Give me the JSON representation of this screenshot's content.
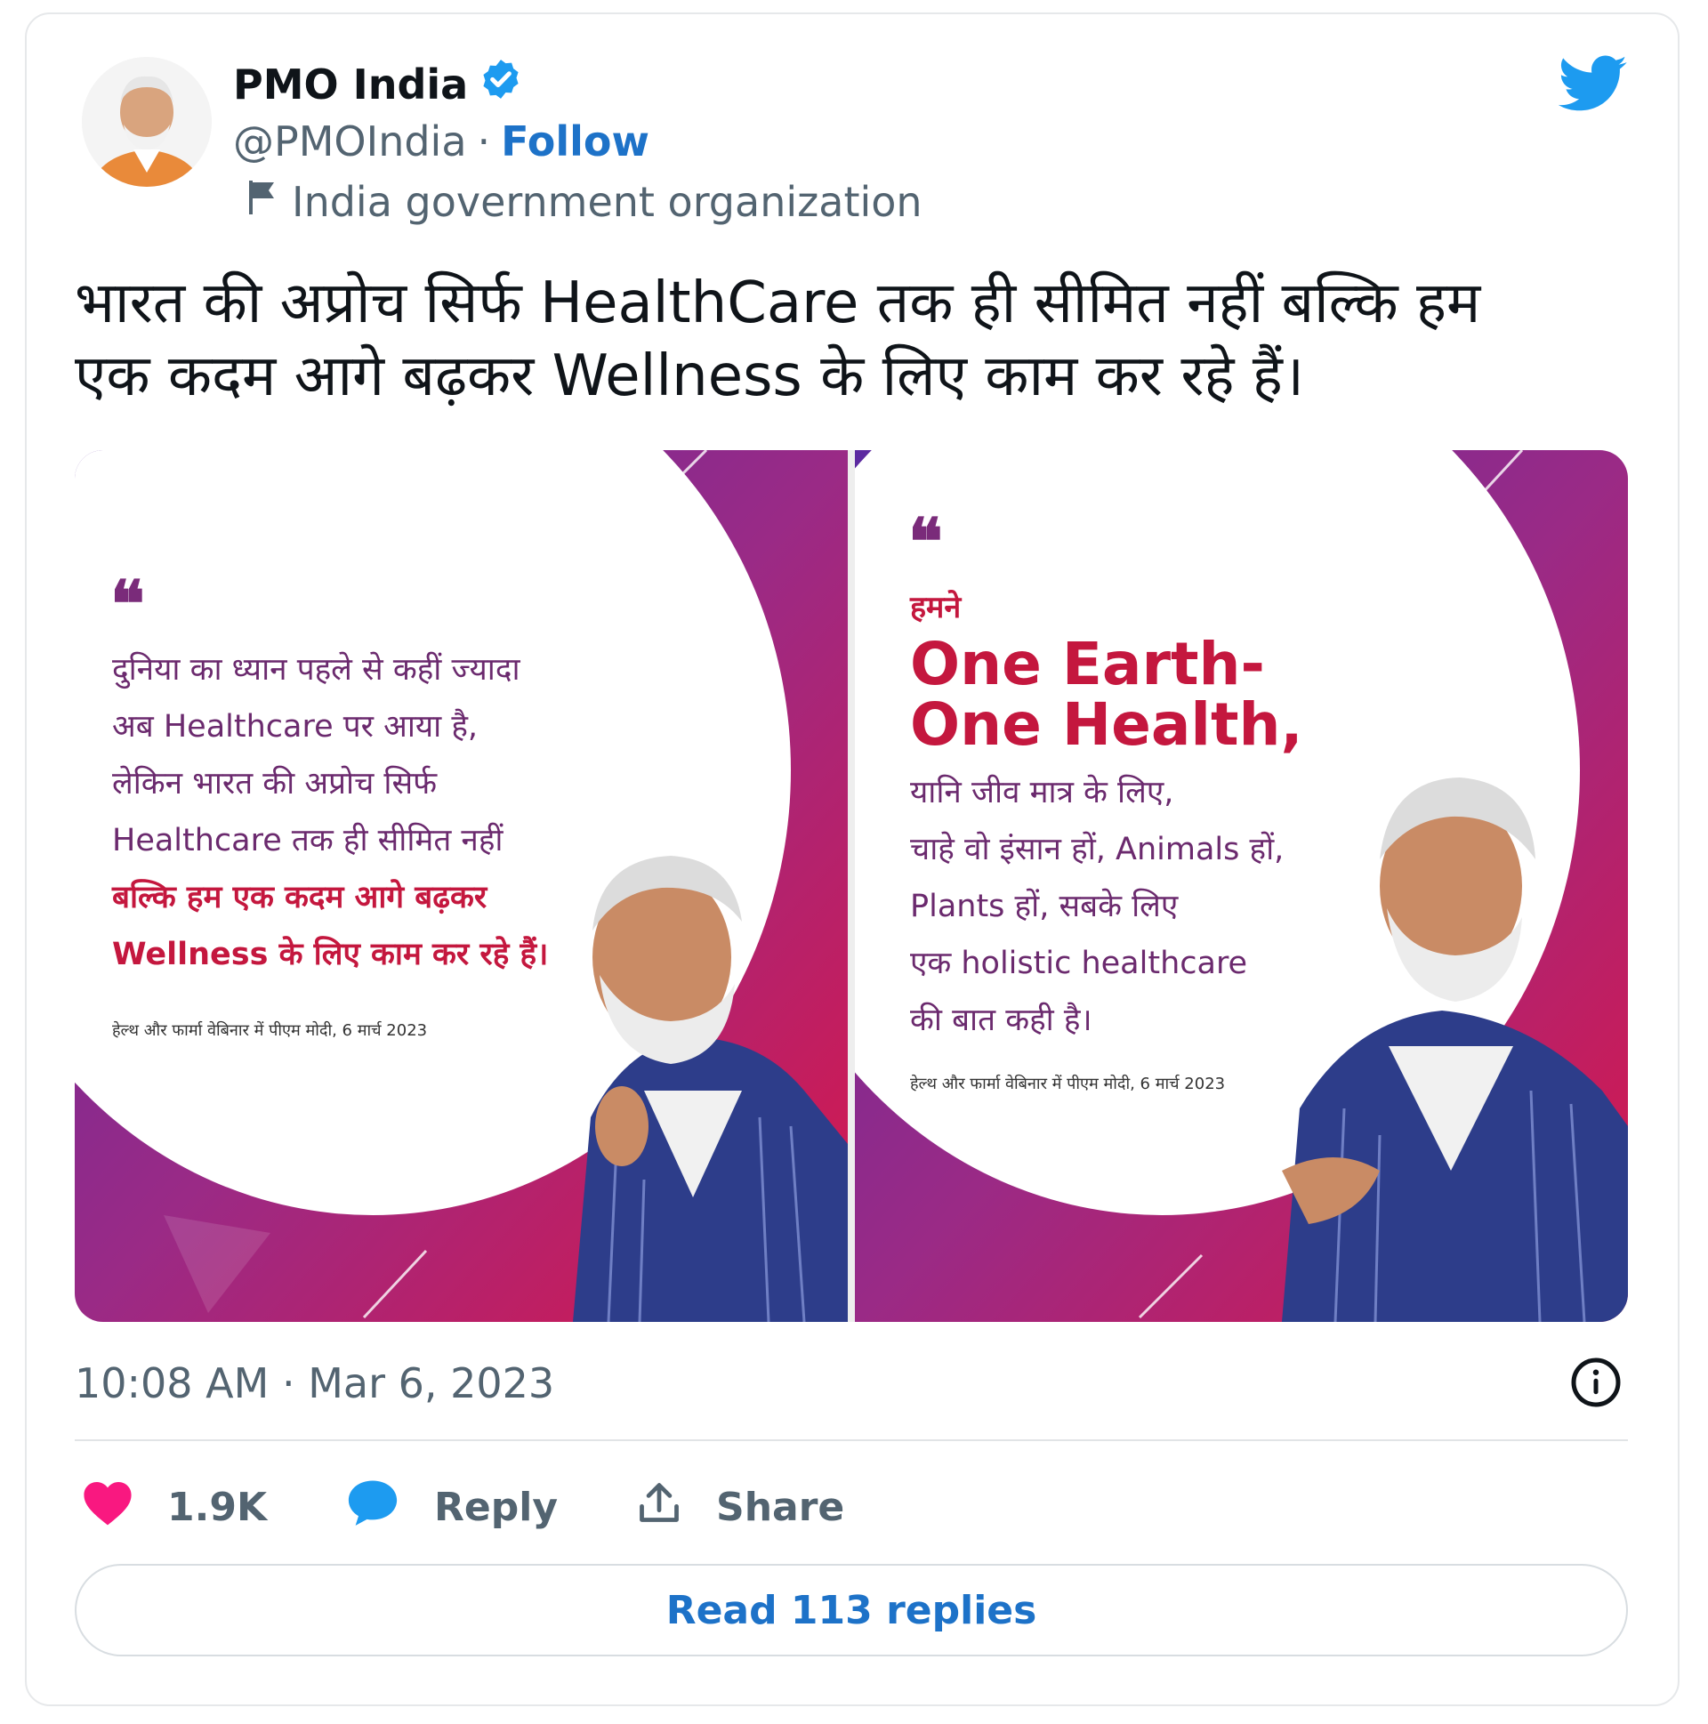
{
  "account": {
    "name": "PMO India",
    "handle": "@PMOIndia",
    "separator": "·",
    "follow_label": "Follow",
    "label": "India government organization"
  },
  "tweet": {
    "text_line1": "भारत की अप्रोच सिर्फ HealthCare तक ही सीमित नहीं बल्कि हम",
    "text_line2": "एक कदम आगे बढ़कर Wellness के लिए काम कर रहे हैं।",
    "timestamp": "10:08 AM · Mar 6, 2023"
  },
  "media": {
    "panel1": {
      "quote_mark": "❝",
      "lines": [
        "दुनिया का ध्यान पहले से कहीं ज्यादा",
        "अब Healthcare पर आया है,",
        "लेकिन भारत की अप्रोच सिर्फ",
        "Healthcare तक ही सीमित नहीं"
      ],
      "highlight_lines": [
        "बल्कि हम एक कदम आगे बढ़कर",
        "Wellness के लिए काम कर रहे हैं।"
      ],
      "credit": "हेल्थ और फार्मा वेबिनार में पीएम मोदी, 6 मार्च 2023"
    },
    "panel2": {
      "quote_mark": "❝",
      "intro": "हमने",
      "headline1": "One Earth-",
      "headline2": "One Health,",
      "lines": [
        "यानि जीव मात्र के लिए,",
        "चाहे वो इंसान हों, Animals हों,",
        "Plants हों, सबके लिए",
        "एक holistic healthcare",
        "की बात कही है।"
      ],
      "credit": "हेल्थ और फार्मा वेबिनार में पीएम मोदी, 6 मार्च 2023"
    }
  },
  "actions": {
    "likes": "1.9K",
    "reply_label": "Reply",
    "share_label": "Share"
  },
  "read_replies_label": "Read 113 replies",
  "colors": {
    "brand_blue": "#1d9bf0",
    "link_blue": "#1d72c8",
    "heart_pink": "#f91880",
    "accent_red": "#c4173e",
    "accent_purple": "#6b2a8e"
  },
  "icons": [
    "verified-badge-icon",
    "twitter-bird-icon",
    "flag-icon",
    "info-icon",
    "heart-icon",
    "reply-bubble-icon",
    "share-icon"
  ]
}
